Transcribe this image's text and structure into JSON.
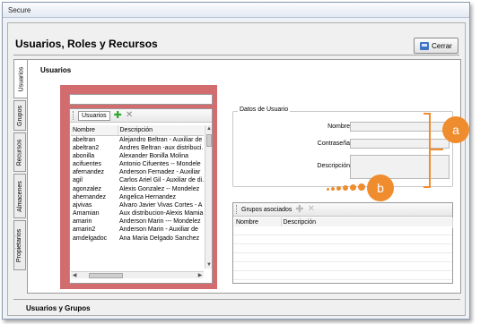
{
  "window": {
    "title": "Secure"
  },
  "header": {
    "title": "Usuarios, Roles y Recursos",
    "close_label": "Cerrar"
  },
  "vertical_tabs": [
    "Usuarios",
    "Grupos",
    "Recursos",
    "Almacenes",
    "Propietarios"
  ],
  "panel": {
    "title": "Usuarios"
  },
  "users_grid": {
    "tab_label": "Usuarios",
    "columns": [
      "Nombre",
      "Descripción"
    ],
    "rows": [
      [
        "abeltran",
        "Alejandro Beltran - Auxiliar de"
      ],
      [
        "abeltran2",
        "Andres Beltran -aux distribuci..."
      ],
      [
        "abonilla",
        "Alexander Bonilla Molina"
      ],
      [
        "acifuentes",
        "Antonio Cifuentes -- Mondele"
      ],
      [
        "afernandez",
        "Anderson Fernadez - Auxiliar"
      ],
      [
        "agil",
        "Carlos Ariel Gil - Auxiliar de di..."
      ],
      [
        "agonzalez",
        "Alexis Gonzalez -- Mondelez"
      ],
      [
        "ahernandez",
        "Angelica Hernandez"
      ],
      [
        "ajvivas",
        "Alvaro Javier Vivas Cortes - A"
      ],
      [
        "Amamian",
        "Aux distribucion-Alexis Mamia"
      ],
      [
        "amarin",
        "Anderson Marin --- Mondelez"
      ],
      [
        "amarin2",
        "Anderson Marin - Auxiliar de"
      ],
      [
        "amdelgadoc",
        "Ana Maria Delgado Sanchez"
      ]
    ]
  },
  "user_data": {
    "legend": "Datos de Usuario",
    "fields": {
      "nombre": "Nombre",
      "contrasena": "Contraseña",
      "descripcion": "Descripción"
    }
  },
  "groups": {
    "label": "Grupos asociados",
    "columns": [
      "Nombre",
      "Descripción"
    ]
  },
  "callouts": {
    "a": "a",
    "b": "b"
  },
  "status": {
    "text": "Usuarios y Grupos"
  },
  "colors": {
    "highlight_red": "#d26c6e",
    "callout_orange": "#ef8c2e",
    "add_green": "#2ea82e"
  },
  "icons": [
    "close-door-icon",
    "add-icon",
    "delete-icon",
    "scroll-up-icon",
    "scroll-down-icon",
    "scroll-left-icon",
    "scroll-right-icon"
  ]
}
